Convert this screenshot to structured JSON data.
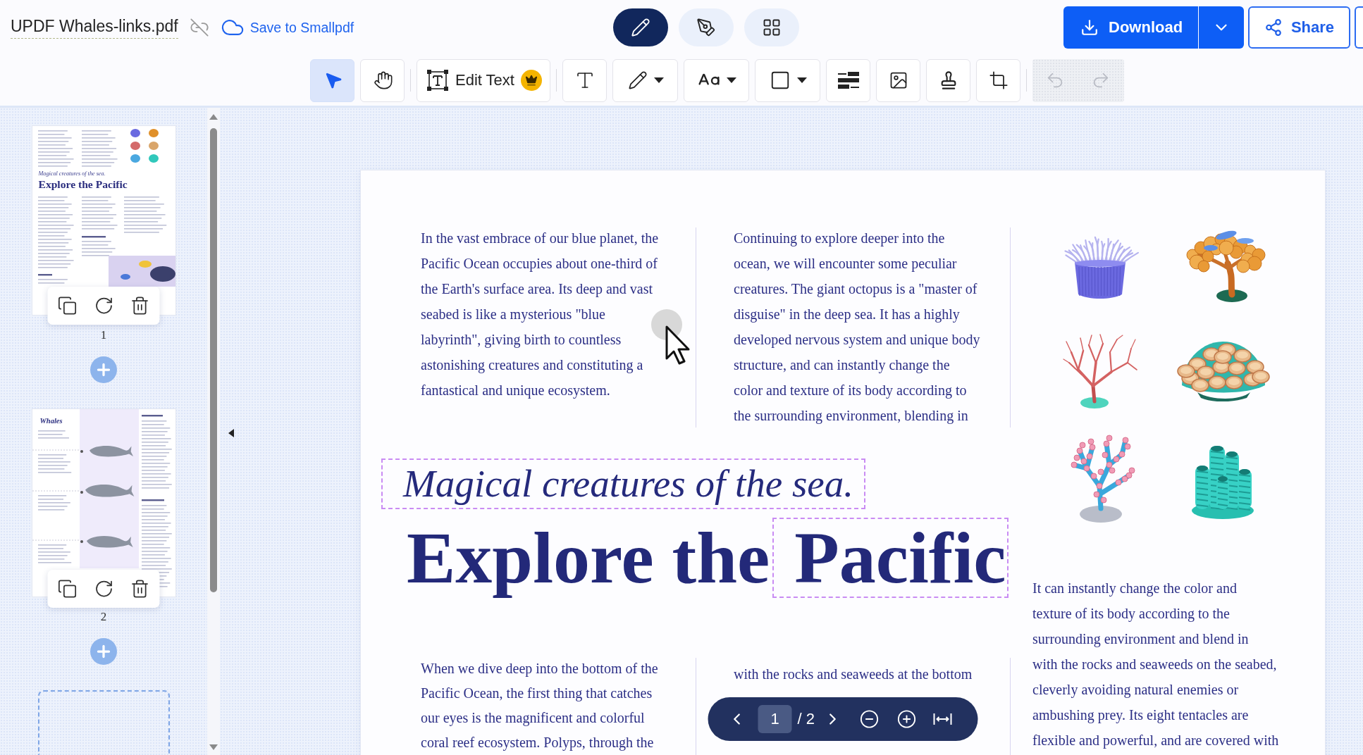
{
  "header": {
    "file_name": "UPDF Whales-links.pdf",
    "save_link": "Save to Smallpdf",
    "modes": [
      {
        "kind": "edit",
        "selected": true
      },
      {
        "kind": "sign",
        "selected": false
      },
      {
        "kind": "organize",
        "selected": false
      }
    ],
    "download": "Download",
    "share": "Share"
  },
  "toolbar": {
    "groups": [
      {
        "tools": [
          {
            "kind": "select",
            "selected": true,
            "dropdown": false,
            "premium": false
          },
          {
            "kind": "hand",
            "selected": false,
            "dropdown": false,
            "premium": false
          }
        ]
      },
      {
        "tools": [
          {
            "kind": "edit_text",
            "label": "Edit Text",
            "selected": false,
            "dropdown": false,
            "premium": true
          }
        ]
      },
      {
        "tools": [
          {
            "kind": "text",
            "selected": false,
            "dropdown": false,
            "premium": false
          },
          {
            "kind": "pencil",
            "selected": false,
            "dropdown": true,
            "premium": false
          },
          {
            "kind": "text_case",
            "selected": false,
            "dropdown": true,
            "premium": false
          },
          {
            "kind": "shape",
            "selected": false,
            "dropdown": true,
            "premium": false
          },
          {
            "kind": "lines",
            "selected": false,
            "dropdown": false,
            "premium": false
          },
          {
            "kind": "image",
            "selected": false,
            "dropdown": false,
            "premium": false
          },
          {
            "kind": "stamp",
            "selected": false,
            "dropdown": false,
            "premium": false
          },
          {
            "kind": "crop",
            "selected": false,
            "dropdown": false,
            "premium": false
          }
        ]
      }
    ],
    "history": [
      {
        "kind": "undo",
        "disabled": true
      },
      {
        "kind": "redo",
        "disabled": true
      }
    ]
  },
  "sidebar": {
    "pages": [
      {
        "kind": "article",
        "number": "1",
        "subtitle": "Magical creatures of the sea.",
        "title": "Explore the Pacific"
      },
      {
        "kind": "whales",
        "number": "2",
        "title": "Whales"
      }
    ]
  },
  "document": {
    "intro": [
      [
        "In the vast embrace of our blue planet, the",
        "Pacific Ocean occupies about one-third of",
        "the Earth's surface area. Its deep and vast",
        "seabed is like a mysterious \"blue",
        "labyrinth\", giving birth to countless",
        "astonishing creatures and constituting a",
        "fantastical and unique ecosystem."
      ],
      [
        "Continuing to explore deeper into the",
        "ocean, we will encounter some peculiar",
        "creatures. The giant octopus is a \"master of",
        "disguise\" in the deep sea. It has a highly",
        "developed nervous system and unique body",
        "structure, and can instantly change the",
        "color and texture of its body according to",
        "the surrounding environment, blending in"
      ]
    ],
    "subtitle": {
      "text": "Magical creatures of the sea.",
      "outlined": true
    },
    "title": [
      {
        "text": "Explore the",
        "outlined": false
      },
      {
        "text": "Pacific",
        "outlined": true
      }
    ],
    "side_text": [
      "It can instantly change the color and",
      "texture of its body according to the",
      "surrounding environment and blend in",
      "with the rocks and seaweeds on the seabed,",
      "cleverly avoiding natural enemies or",
      "ambushing prey. Its eight tentacles are",
      "flexible and powerful, and are covered with"
    ],
    "body": [
      [
        "When we dive deep into the bottom of the",
        "Pacific Ocean, the first thing that catches",
        "our eyes is the magnificent and colorful",
        "coral reef ecosystem. Polyps, through the"
      ],
      [
        "with the rocks and seaweeds at the bottom"
      ]
    ]
  },
  "pager": {
    "page": "1",
    "total": "/ 2"
  }
}
